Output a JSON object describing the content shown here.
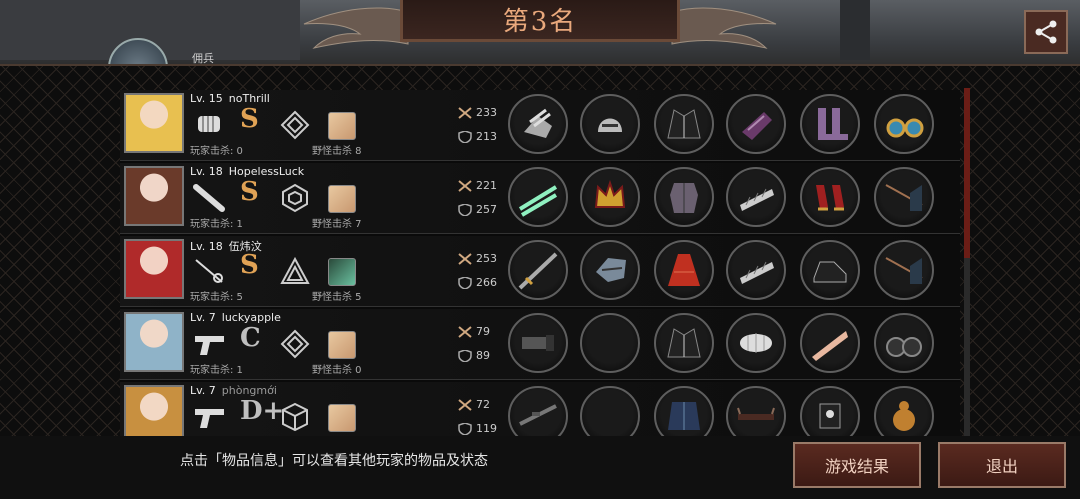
{
  "header": {
    "title": "第3名",
    "player_name": "佣兵"
  },
  "rows": [
    {
      "level": "Lv. 15",
      "name": "noThrill",
      "grade": "S",
      "player_kills": "玩家击杀: 0",
      "monster_kills": "野怪击杀 8",
      "attack": "233",
      "defense": "213",
      "weapon_icon": "fist-icon",
      "rank_icon": "diamond-rank-icon",
      "avatar_colors": [
        "#e8c050",
        "#f3d8c0"
      ],
      "items": [
        "gauntlet-icon",
        "helmet-icon",
        "coat-icon",
        "glove-icon",
        "boots-icon",
        "earring-icon"
      ]
    },
    {
      "level": "Lv. 18",
      "name": "HopelessLuck",
      "grade": "S",
      "player_kills": "玩家击杀: 1",
      "monster_kills": "野怪击杀 7",
      "attack": "221",
      "defense": "257",
      "weapon_icon": "bat-icon",
      "rank_icon": "hexagon-rank-icon",
      "avatar_colors": [
        "#6a3a2a",
        "#f0d6c8"
      ],
      "items": [
        "dual-swords-icon",
        "crown-icon",
        "armor-icon",
        "bracer-icon",
        "heels-icon",
        "spear-icon"
      ]
    },
    {
      "level": "Lv. 18",
      "name": "伍炜汶",
      "grade": "S",
      "player_kills": "玩家击杀: 5",
      "monster_kills": "野怪击杀 5",
      "attack": "253",
      "defense": "266",
      "weapon_icon": "rapier-icon",
      "rank_icon": "triangle-rank-icon",
      "avatar_colors": [
        "#b02a2a",
        "#f2d2c4"
      ],
      "items": [
        "sword-icon",
        "mask-helmet-icon",
        "dress-icon",
        "bracer-icon",
        "sneakers-icon",
        "spear-icon"
      ]
    },
    {
      "level": "Lv. 7",
      "name": "luckyapple",
      "grade": "C",
      "player_kills": "玩家击杀: 1",
      "monster_kills": "野怪击杀 0",
      "attack": "79",
      "defense": "89",
      "weapon_icon": "pistol-icon",
      "rank_icon": "diamond-rank-icon",
      "avatar_colors": [
        "#8fb3c8",
        "#f0d8c8"
      ],
      "items": [
        "minigun-icon",
        "empty-slot",
        "coat-icon",
        "bandage-icon",
        "leg-icon",
        "binoculars-icon"
      ]
    },
    {
      "level": "Lv. 7",
      "name": "phòngmới",
      "grade": "D+",
      "player_kills": "",
      "monster_kills": "",
      "attack": "72",
      "defense": "119",
      "weapon_icon": "pistol-icon",
      "rank_icon": "cube-rank-icon",
      "avatar_colors": [
        "#c89040",
        "#f2d8c4"
      ],
      "items": [
        "rifle-icon",
        "empty-slot",
        "vest-icon",
        "glasses-icon",
        "glove-dark-icon",
        "gourd-icon"
      ]
    }
  ],
  "footer": {
    "hint": "点击「物品信息」可以查看其他玩家的物品及状态",
    "result_button": "游戏结果",
    "exit_button": "退出"
  }
}
